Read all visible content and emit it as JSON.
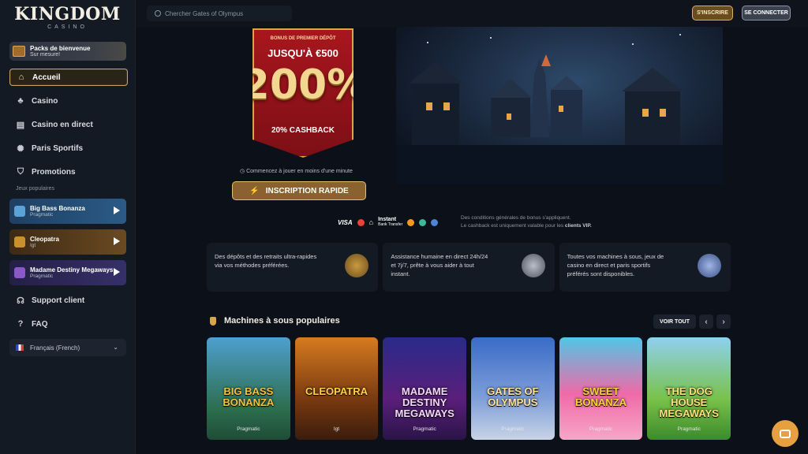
{
  "brand": {
    "name": "KINGDOM",
    "sub": "CASINO"
  },
  "sidebar": {
    "welcome": {
      "title": "Packs de bienvenue",
      "subtitle": "Sur mesure!"
    },
    "nav": [
      {
        "label": "Accueil",
        "icon": "home-icon"
      },
      {
        "label": "Casino",
        "icon": "cherries-icon"
      },
      {
        "label": "Casino en direct",
        "icon": "cards-icon"
      },
      {
        "label": "Paris Sportifs",
        "icon": "soccer-ball-icon"
      },
      {
        "label": "Promotions",
        "icon": "shield-icon"
      }
    ],
    "popular_label": "Jeux populaires",
    "popular_games": [
      {
        "title": "Big Bass Bonanza",
        "provider": "Pragmatic"
      },
      {
        "title": "Cleopatra",
        "provider": "Igt"
      },
      {
        "title": "Madame Destiny Megaways",
        "provider": "Pragmatic"
      }
    ],
    "support": "Support client",
    "faq": "FAQ",
    "language": "Français (French)"
  },
  "topbar": {
    "search_placeholder": "Chercher Gates of Olympus",
    "register": "S'INSCRIRE",
    "login": "SE CONNECTER"
  },
  "hero": {
    "small": "BONUS DE PREMIER DÉPÔT",
    "upto": "JUSQU'À €500",
    "percent": "200%",
    "cashback": "20% CASHBACK",
    "note": "Commencez à jouer en moins d'une minute",
    "cta": "INSCRIPTION RAPIDE"
  },
  "payments": {
    "visa": "VISA",
    "instant": "Instant",
    "bank": "Bank Transfer"
  },
  "terms": {
    "line1": "Des conditions générales de bonus s'appliquent.",
    "line2a": "Le cashback est uniquement valable pour les ",
    "line2b": "clients VIP."
  },
  "features": [
    "Des dépôts et des retraits ultra-rapides via vos méthodes préférées.",
    "Assistance humaine en direct 24h/24 et 7j/7, prête à vous aider à tout instant.",
    "Toutes vos machines à sous, jeux de casino en direct et paris sportifs préférés sont disponibles."
  ],
  "slots": {
    "title": "Machines à sous populaires",
    "see_all": "VOIR TOUT",
    "games": [
      {
        "name": "BIG BASS BONANZA",
        "provider": "Pragmatic"
      },
      {
        "name": "CLEOPATRA",
        "provider": "Igt"
      },
      {
        "name": "MADAME DESTINY MEGAWAYS",
        "provider": "Pragmatic"
      },
      {
        "name": "GATES OF OLYMPUS",
        "provider": "Pragmatic"
      },
      {
        "name": "SWEET BONANZA",
        "provider": "Pragmatic"
      },
      {
        "name": "THE DOG HOUSE MEGAWAYS",
        "provider": "Pragmatic"
      }
    ]
  },
  "colors": {
    "gold": "#d7a54a",
    "banner_red": "#a8161d",
    "bg": "#0c1119"
  }
}
